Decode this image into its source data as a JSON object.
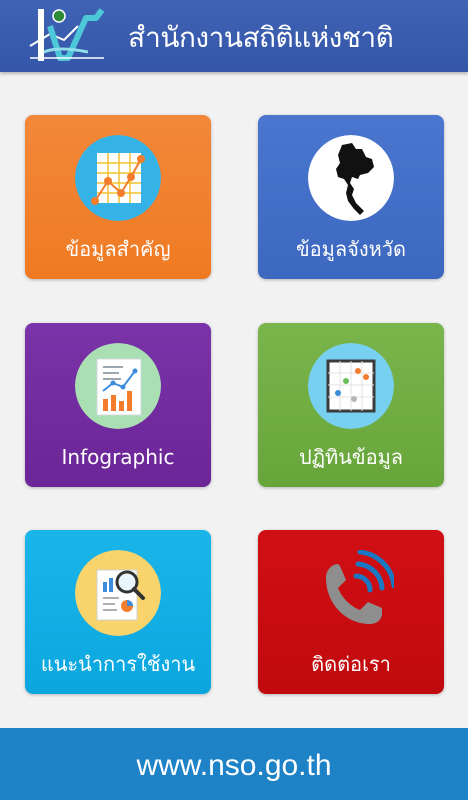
{
  "header": {
    "title": "สำนักงานสถิติแห่งชาติ",
    "logo_icon": "nso-logo-icon"
  },
  "menu": {
    "items": [
      {
        "label": "ข้อมูลสำคัญ",
        "icon": "line-chart-icon",
        "color": "#f08229"
      },
      {
        "label": "ข้อมูลจังหวัด",
        "icon": "thailand-map-icon",
        "color": "#4170c8"
      },
      {
        "label": "Infographic",
        "icon": "infographic-document-icon",
        "color": "#732d9f"
      },
      {
        "label": "ปฏิทินข้อมูล",
        "icon": "calendar-grid-icon",
        "color": "#71ae43"
      },
      {
        "label": "แนะนำการใช้งาน",
        "icon": "magnifier-report-icon",
        "color": "#13aee4"
      },
      {
        "label": "ติดต่อเรา",
        "icon": "phone-icon",
        "color": "#c80c11"
      }
    ]
  },
  "footer": {
    "url": "www.nso.go.th",
    "color": "#1d82c6"
  }
}
